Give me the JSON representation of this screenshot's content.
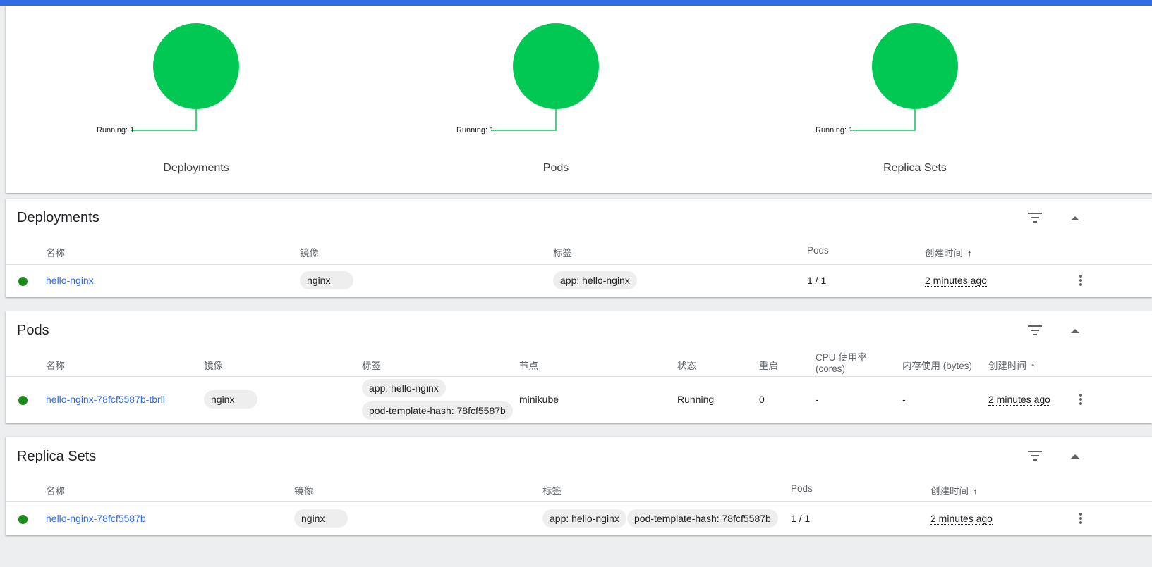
{
  "colors": {
    "accent": "#326de6",
    "running": "#00c853",
    "status_ok": "#1a8b1a"
  },
  "summary": {
    "charts": [
      {
        "title": "Deployments",
        "running_label": "Running: 1"
      },
      {
        "title": "Pods",
        "running_label": "Running: 1"
      },
      {
        "title": "Replica Sets",
        "running_label": "Running: 1"
      }
    ]
  },
  "deployments": {
    "title": "Deployments",
    "headers": {
      "name": "名称",
      "image": "镜像",
      "labels": "标签",
      "pods": "Pods",
      "created": "创建时间"
    },
    "rows": [
      {
        "name": "hello-nginx",
        "image": "nginx",
        "labels": [
          "app: hello-nginx"
        ],
        "pods": "1 / 1",
        "created": "2 minutes ago"
      }
    ]
  },
  "pods": {
    "title": "Pods",
    "headers": {
      "name": "名称",
      "image": "镜像",
      "labels": "标签",
      "node": "节点",
      "status": "状态",
      "restarts": "重启",
      "cpu": "CPU 使用率 (cores)",
      "cpu_line1": "CPU 使用率",
      "cpu_line2": "(cores)",
      "memory": "内存使用 (bytes)",
      "created": "创建时间"
    },
    "rows": [
      {
        "name": "hello-nginx-78fcf5587b-tbrll",
        "image": "nginx",
        "labels": [
          "app: hello-nginx",
          "pod-template-hash: 78fcf5587b"
        ],
        "node": "minikube",
        "status": "Running",
        "restarts": "0",
        "cpu": "-",
        "memory": "-",
        "created": "2 minutes ago"
      }
    ]
  },
  "replica_sets": {
    "title": "Replica Sets",
    "headers": {
      "name": "名称",
      "image": "镜像",
      "labels": "标签",
      "pods": "Pods",
      "created": "创建时间"
    },
    "rows": [
      {
        "name": "hello-nginx-78fcf5587b",
        "image": "nginx",
        "labels": [
          "app: hello-nginx",
          "pod-template-hash: 78fcf5587b"
        ],
        "pods": "1 / 1",
        "created": "2 minutes ago"
      }
    ]
  },
  "icons": {
    "filter": "filter-icon",
    "collapse": "collapse-icon",
    "more": "more-vert-icon",
    "sort": "sort-arrow-up-icon"
  }
}
